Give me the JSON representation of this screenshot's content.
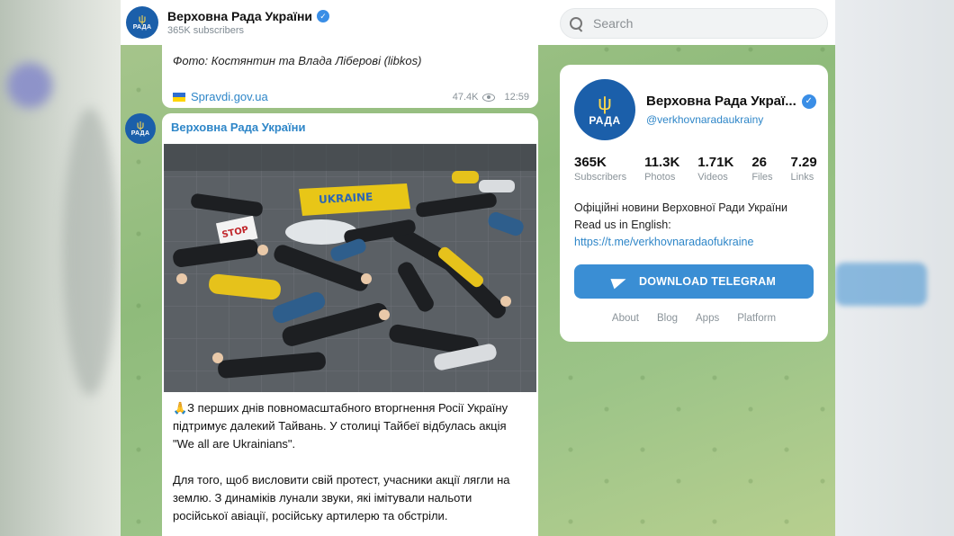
{
  "header": {
    "channel_name": "Верховна Рада України",
    "subscribers": "365K subscribers",
    "search_placeholder": "Search"
  },
  "avatar": {
    "text": "РАДА"
  },
  "previous_post": {
    "caption": "Фото: Костянтин та Влада Ліберові (libkos)",
    "link": "Spravdi.gov.ua",
    "views": "47.4K",
    "time": "12:59"
  },
  "post": {
    "author": "Верховна Рада України",
    "photo_sign_ukraine": "UKRAINE",
    "photo_sign_stop": "STOP",
    "paragraph1": "🙏З перших днів повномасштабного вторгнення Росії Україну підтримує далекий Тайвань. У столиці Тайбеї відбулась акція \"We all are Ukrainians\".",
    "paragraph2": "Для того, щоб висловити свій протест, учасники акції лягли на землю. З динаміків лунали звуки, які імітували нальоти російської авіації, російську артилерю та обстріли."
  },
  "card": {
    "title": "Верховна Рада Украї...",
    "handle": "@verkhovnaradaukrainy",
    "stats": [
      {
        "value": "365K",
        "label": "Subscribers"
      },
      {
        "value": "11.3K",
        "label": "Photos"
      },
      {
        "value": "1.71K",
        "label": "Videos"
      },
      {
        "value": "26",
        "label": "Files"
      },
      {
        "value": "7.29",
        "label": "Links"
      }
    ],
    "desc_line1": "Офіційні новини Верховної Ради України",
    "desc_line2": "Read us in English:",
    "desc_link": "https://t.me/verkhovnaradaofukraine",
    "download_label": "DOWNLOAD TELEGRAM",
    "footer": [
      "About",
      "Blog",
      "Apps",
      "Platform"
    ]
  },
  "colors": {
    "accent": "#3a8ed4",
    "link": "#2e86c8",
    "brand_blue": "#1b5faa"
  }
}
